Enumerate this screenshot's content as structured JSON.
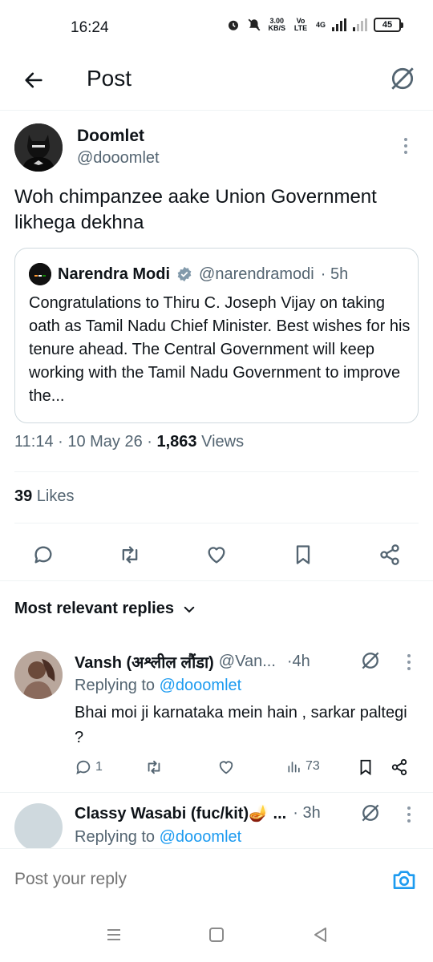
{
  "status_bar": {
    "time": "16:24",
    "net_speed_value": "3.00",
    "net_speed_unit": "KB/S",
    "volte": "Vo LTE",
    "network": "4G",
    "battery": "45"
  },
  "header": {
    "title": "Post"
  },
  "post": {
    "author_name": "Doomlet",
    "author_handle": "@dooomlet",
    "text": "Woh chimpanzee aake Union Government likhega dekhna",
    "quote": {
      "name": "Narendra Modi",
      "handle": "@narendramodi",
      "time": "· 5h",
      "text": "Congratulations to Thiru C. Joseph Vijay on taking oath as Tamil Nadu Chief Minister. Best wishes for his tenure ahead. The Central Government will keep working with the Tamil Nadu Government to improve the..."
    },
    "timestamp": "11:14 · 10 May 26 · ",
    "views_count": "1,863",
    "views_label": " Views",
    "likes_count": "39",
    "likes_label": " Likes"
  },
  "replies_section": {
    "heading": "Most relevant replies"
  },
  "replies": [
    {
      "name": "Vansh (अश्लील लौंडा)",
      "handle": "@Van...",
      "time": "·4h",
      "replying_label": "Replying to ",
      "replying_handle": "@dooomlet",
      "text": "Bhai moi ji karnataka mein hain , sarkar paltegi ?",
      "reply_count": "1",
      "views": "73"
    },
    {
      "name": "Classy Wasabi (fuc/kit)🪔 ...",
      "time": "· 3h",
      "replying_label": "Replying to ",
      "replying_handle": "@dooomlet"
    }
  ],
  "reply_box": {
    "placeholder": "Post your reply"
  },
  "colors": {
    "accent": "#1d9bf0",
    "secondary_text": "#536471",
    "divider": "#eff3f4"
  }
}
